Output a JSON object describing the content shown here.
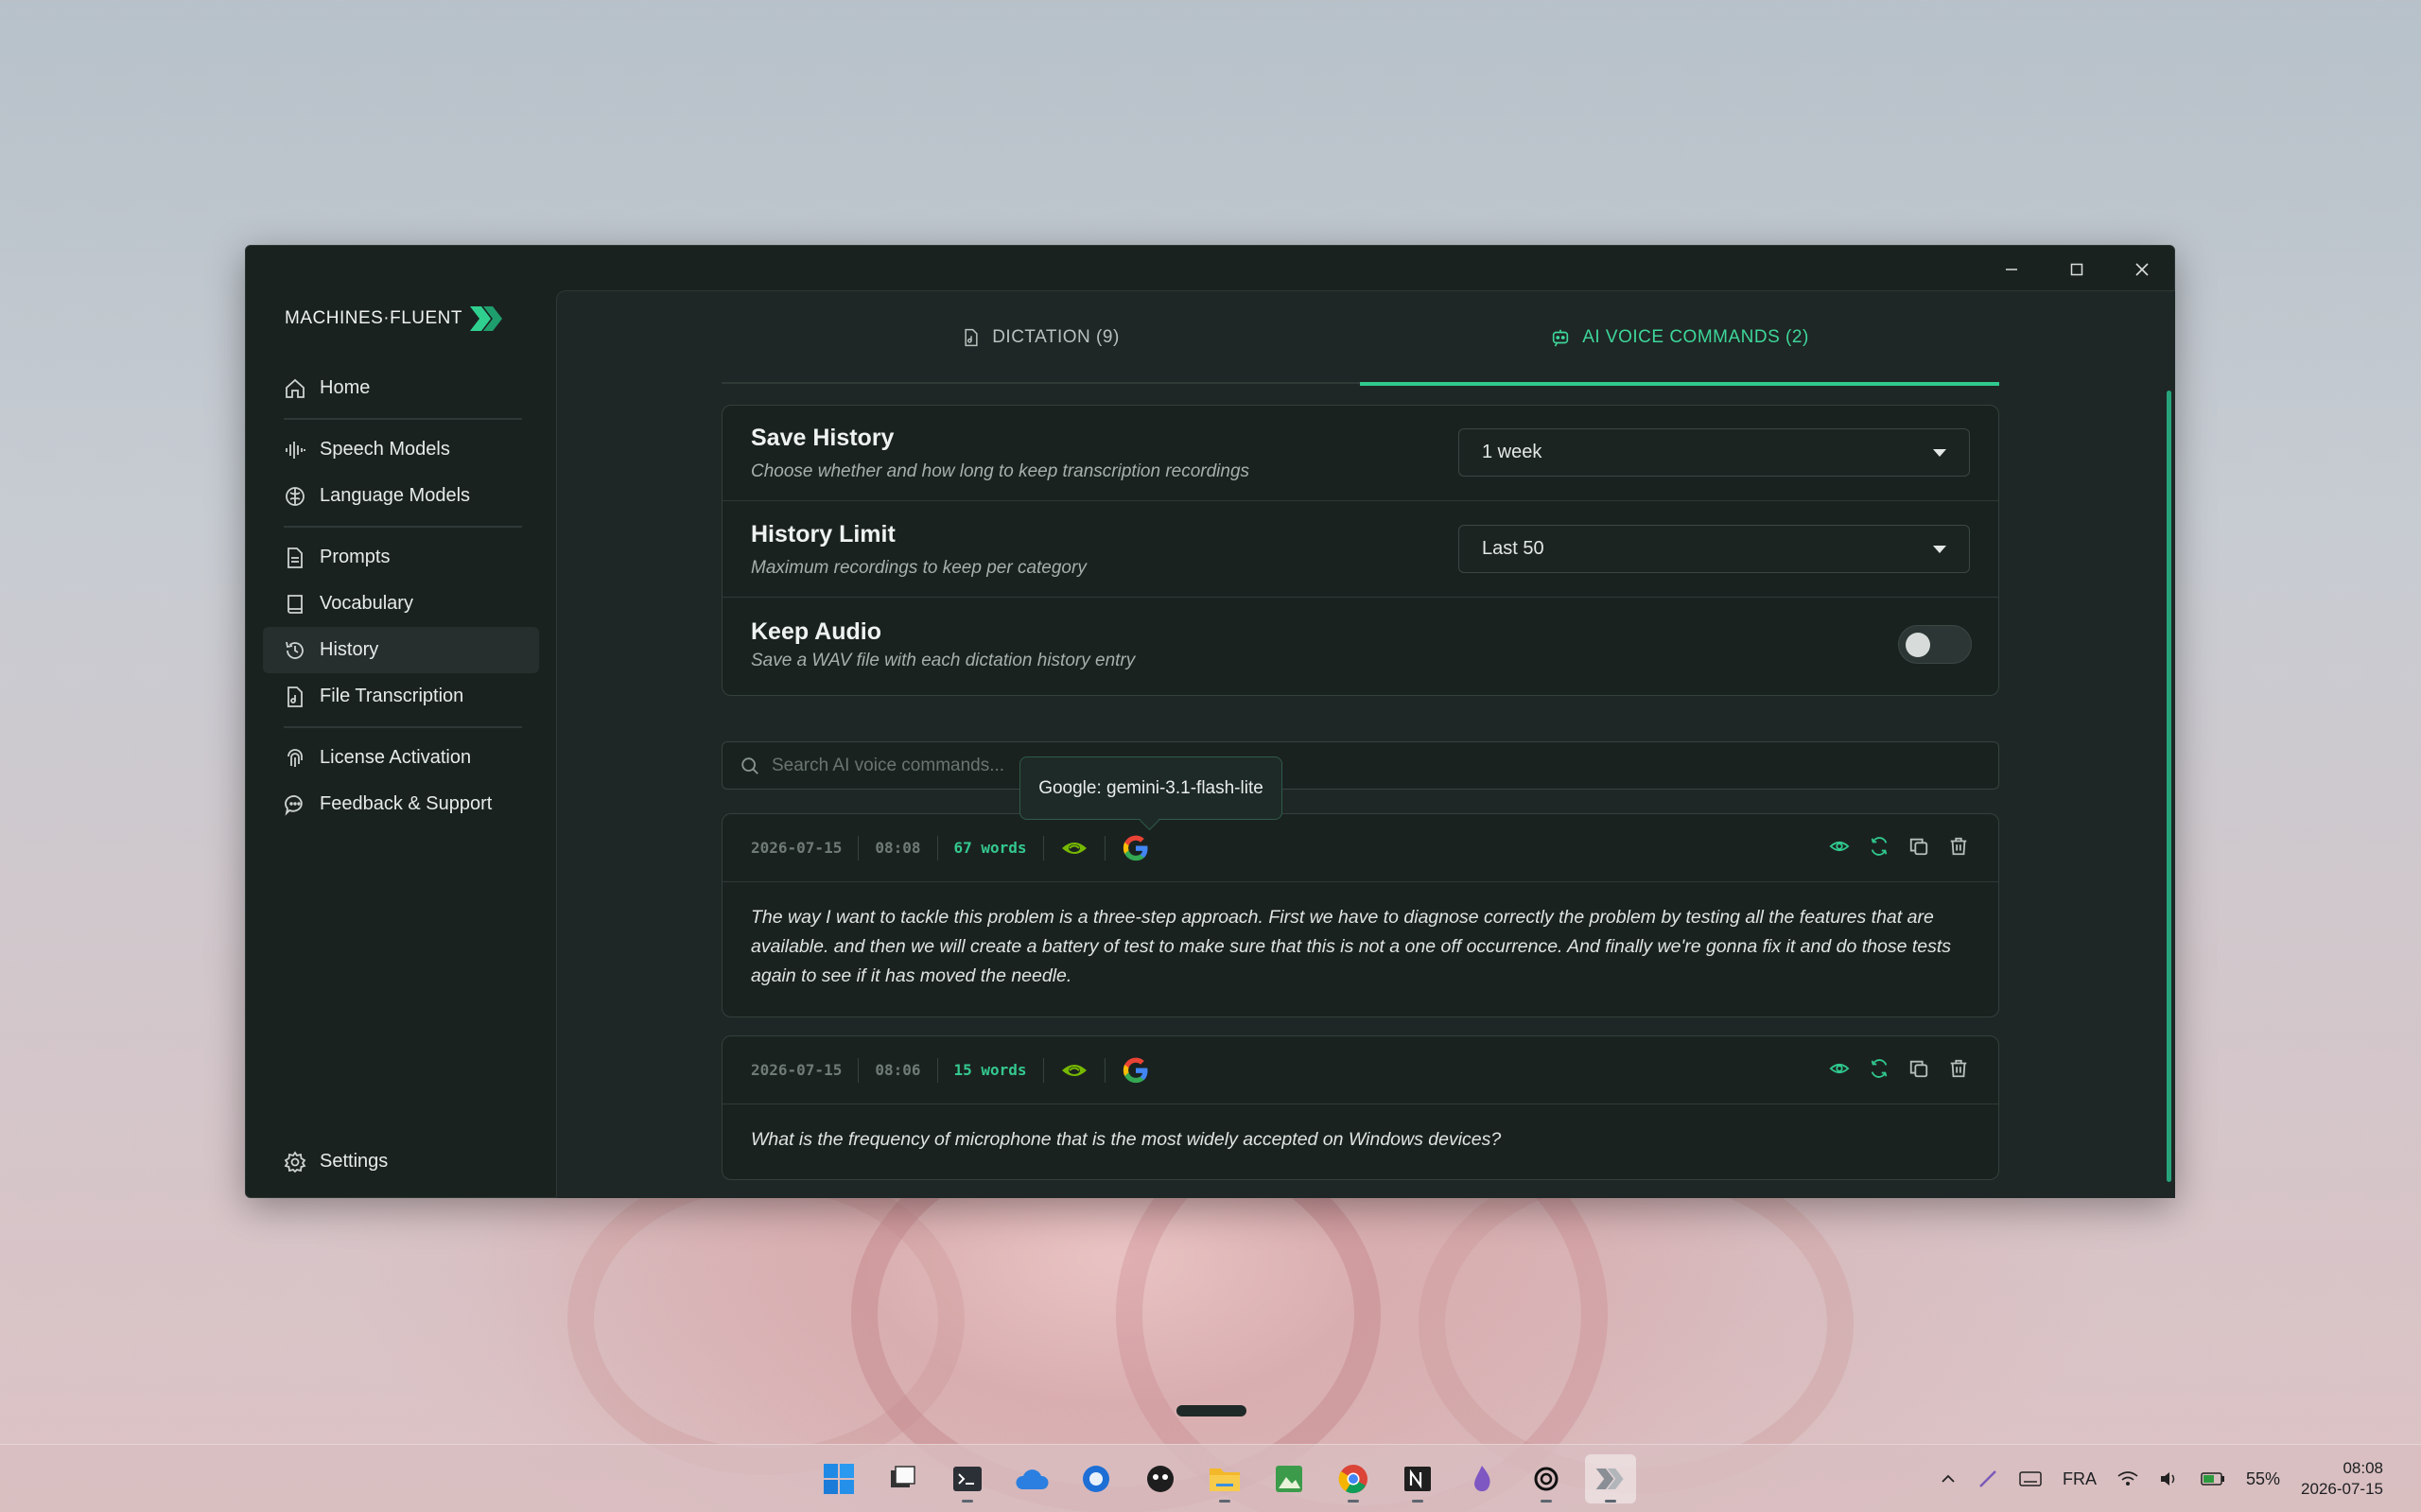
{
  "app": {
    "logo_text": "MACHINES·FLUENT"
  },
  "sidebar": {
    "items": [
      {
        "label": "Home"
      },
      {
        "label": "Speech Models"
      },
      {
        "label": "Language Models"
      },
      {
        "label": "Prompts"
      },
      {
        "label": "Vocabulary"
      },
      {
        "label": "History"
      },
      {
        "label": "File Transcription"
      },
      {
        "label": "License Activation"
      },
      {
        "label": "Feedback & Support"
      }
    ],
    "settings_label": "Settings",
    "active": "History"
  },
  "tabs": [
    {
      "label": "DICTATION (9)"
    },
    {
      "label": "AI VOICE COMMANDS (2)"
    }
  ],
  "settings": {
    "save_history": {
      "title": "Save History",
      "desc": "Choose whether and how long to keep transcription recordings",
      "value": "1 week"
    },
    "history_limit": {
      "title": "History Limit",
      "desc": "Maximum recordings to keep per category",
      "value": "Last 50"
    },
    "keep_audio": {
      "title": "Keep Audio",
      "desc": "Save a WAV file with each dictation history entry",
      "enabled": false
    }
  },
  "search": {
    "placeholder": "Search AI voice commands..."
  },
  "tooltip": "Google: gemini-3.1-flash-lite",
  "entries": [
    {
      "date": "2026-07-15",
      "time": "08:08",
      "words": "67 words",
      "text": "The way I want to tackle this problem is a three-step approach. First we have to diagnose correctly the problem by testing all the features that are available. and then we will create a battery of test to make sure that this is not a one off occurrence. And finally we're gonna fix it and do those tests again to see if it has moved the needle."
    },
    {
      "date": "2026-07-15",
      "time": "08:06",
      "words": "15 words",
      "text": "What is the frequency of microphone that is the most widely accepted on Windows devices?"
    }
  ],
  "taskbar": {
    "language": "FRA",
    "battery": "55%",
    "time": "08:08",
    "date": "2026-07-15"
  },
  "colors": {
    "accent": "#30c98e",
    "bg": "#1a2220"
  }
}
